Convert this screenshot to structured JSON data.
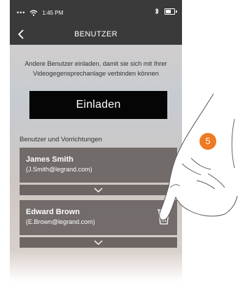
{
  "status_bar": {
    "signal": "•••",
    "time": "1:45 PM",
    "bluetooth": "∦"
  },
  "header": {
    "title": "BENUTZER"
  },
  "invite": {
    "text_line1": "Andere Benutzer einladen, damit sie sich mit Ihrer",
    "text_line2": "Videogegensprechanlage verbinden können",
    "button_label": "Einladen"
  },
  "users_section": {
    "label": "Benutzer und Vorrichtungen",
    "users": [
      {
        "name": "James Smith",
        "email": "(J.Smith@legrand.com)"
      },
      {
        "name": "Edward Brown",
        "email": "(E.Brown@legrand.com)"
      }
    ]
  },
  "annotation": {
    "step": "5"
  },
  "colors": {
    "status_bar_bg": "#3a3a3a",
    "card_bg": "#5a5452",
    "step_badge": "#ee7a23"
  },
  "icons": [
    "wifi-icon",
    "bluetooth-icon",
    "battery-icon",
    "back-chevron-icon",
    "chevron-down-icon",
    "trash-icon",
    "pointing-hand-icon"
  ]
}
